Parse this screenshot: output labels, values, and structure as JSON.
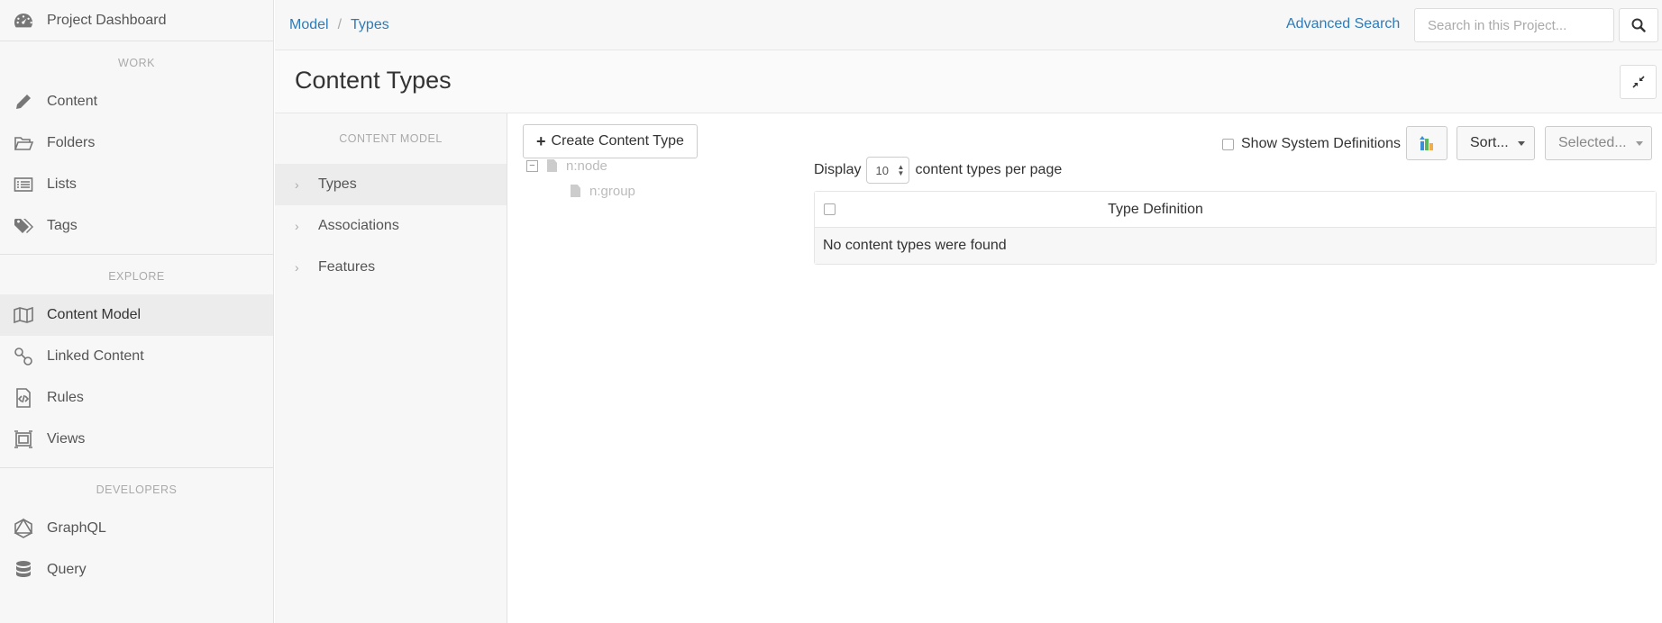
{
  "sidebar": {
    "dashboard_label": "Project Dashboard",
    "sections": {
      "work": "WORK",
      "explore": "EXPLORE",
      "developers": "DEVELOPERS"
    },
    "work_items": [
      {
        "label": "Content",
        "icon": "pencil-icon"
      },
      {
        "label": "Folders",
        "icon": "folder-icon"
      },
      {
        "label": "Lists",
        "icon": "list-icon"
      },
      {
        "label": "Tags",
        "icon": "tags-icon"
      }
    ],
    "explore_items": [
      {
        "label": "Content Model",
        "icon": "map-icon",
        "active": true
      },
      {
        "label": "Linked Content",
        "icon": "link-icon"
      },
      {
        "label": "Rules",
        "icon": "code-file-icon"
      },
      {
        "label": "Views",
        "icon": "views-icon"
      }
    ],
    "developer_items": [
      {
        "label": "GraphQL",
        "icon": "graphql-icon"
      },
      {
        "label": "Query",
        "icon": "database-icon"
      }
    ]
  },
  "topbar": {
    "breadcrumb": [
      "Model",
      "Types"
    ],
    "breadcrumb_separator": "/",
    "advanced_search": "Advanced Search",
    "search_placeholder": "Search in this Project..."
  },
  "page": {
    "title": "Content Types"
  },
  "content_model": {
    "title": "CONTENT MODEL",
    "items": [
      {
        "label": "Types",
        "active": true
      },
      {
        "label": "Associations"
      },
      {
        "label": "Features"
      }
    ]
  },
  "main": {
    "create_button": "Create Content Type",
    "show_system_definitions": "Show System Definitions",
    "show_system_definitions_checked": false,
    "sort_button": "Sort...",
    "selected_button": "Selected...",
    "tree": [
      {
        "label": "n:node",
        "expanded": true,
        "children": [
          {
            "label": "n:group"
          }
        ]
      }
    ],
    "display_prefix": "Display",
    "page_size": "10",
    "display_suffix": "content types per page",
    "table": {
      "header": "Type Definition",
      "empty_message": "No content types were found"
    }
  },
  "colors": {
    "link": "#2f7bb8",
    "sidebar_bg": "#f7f7f7",
    "active_bg": "#ececec"
  }
}
